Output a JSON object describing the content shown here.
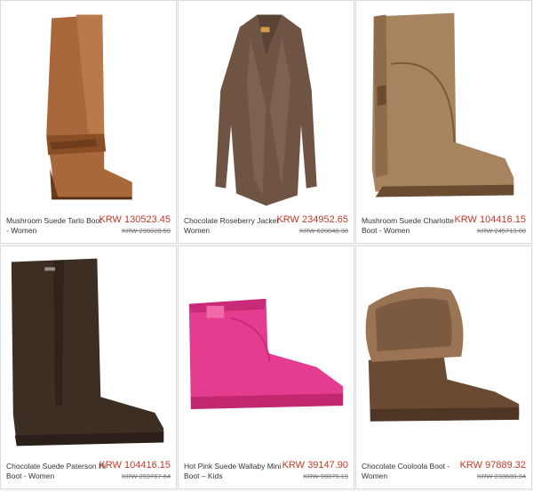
{
  "products": [
    {
      "name": "Mushroom Suede Tarlo Boot - Women",
      "price": "KRW 130523.45",
      "old_price": "KRW 298028.59",
      "image": "tan-tall-wedge-boot"
    },
    {
      "name": "Chocolate Roseberry Jacket - Women",
      "price": "KRW 234952.65",
      "old_price": "KRW 620048.38",
      "image": "brown-suede-jacket"
    },
    {
      "name": "Mushroom Suede Charlotte Boot - Women",
      "price": "KRW 104416.15",
      "old_price": "KRW 245713.00",
      "image": "tan-mid-calf-boot"
    },
    {
      "name": "Chocolate Suede Paterson Hi Boot - Women",
      "price": "KRW 104416.15",
      "old_price": "KRW 259767.64",
      "image": "dark-brown-tall-boot"
    },
    {
      "name": "Hot Pink Suede Wallaby Mini Boot – Kids",
      "price": "KRW 39147.90",
      "old_price": "KRW 99079.19",
      "image": "pink-mini-boot"
    },
    {
      "name": "Chocolate Cooloola Boot - Women",
      "price": "KRW 97889.32",
      "old_price": "KRW 233680.34",
      "image": "brown-fur-cuff-boot"
    }
  ],
  "colors": {
    "price": "#c0392b",
    "text": "#333333",
    "strike": "#777777"
  }
}
